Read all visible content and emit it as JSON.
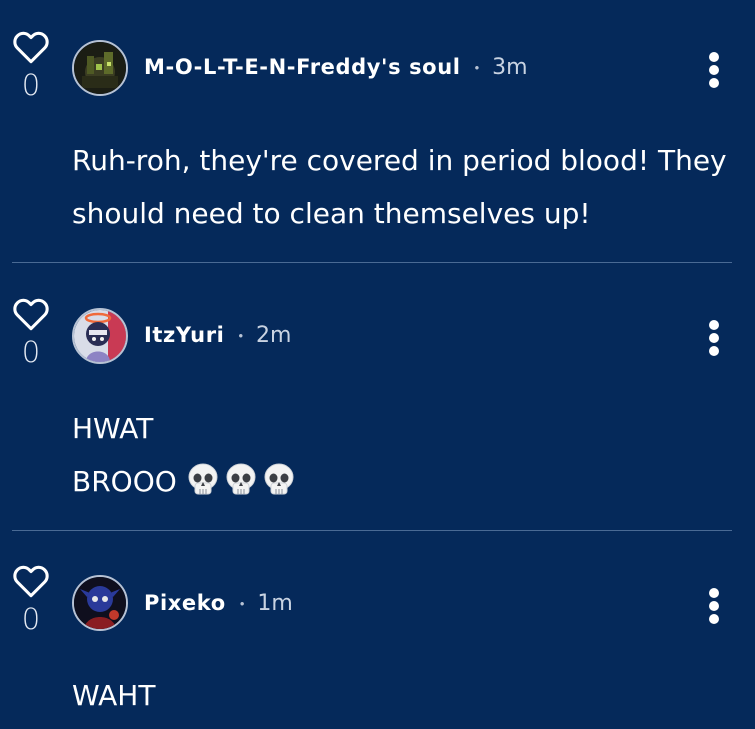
{
  "comments": [
    {
      "username": "M-O-L-T-E-N-Freddy's soul",
      "time": "3m",
      "like_count": "0",
      "lines": [
        "Ruh-roh, they're covered in period blood! They",
        "should need to clean themselves up!"
      ]
    },
    {
      "username": "ItzYuri",
      "time": "2m",
      "like_count": "0",
      "lines": [
        "HWAT",
        "BROOO"
      ],
      "emoji": [
        "skull-emoji",
        "skull-emoji",
        "skull-emoji"
      ]
    },
    {
      "username": "Pixeko",
      "time": "1m",
      "like_count": "0",
      "lines": [
        "WAHT"
      ]
    }
  ],
  "separator": "•",
  "icons": {
    "like": "heart-outline-icon",
    "more": "vertical-ellipsis-icon"
  },
  "colors": {
    "background": "#05295a",
    "text": "#ffffff",
    "muted": "#c9d3e2",
    "divider": "#4a6a94"
  }
}
